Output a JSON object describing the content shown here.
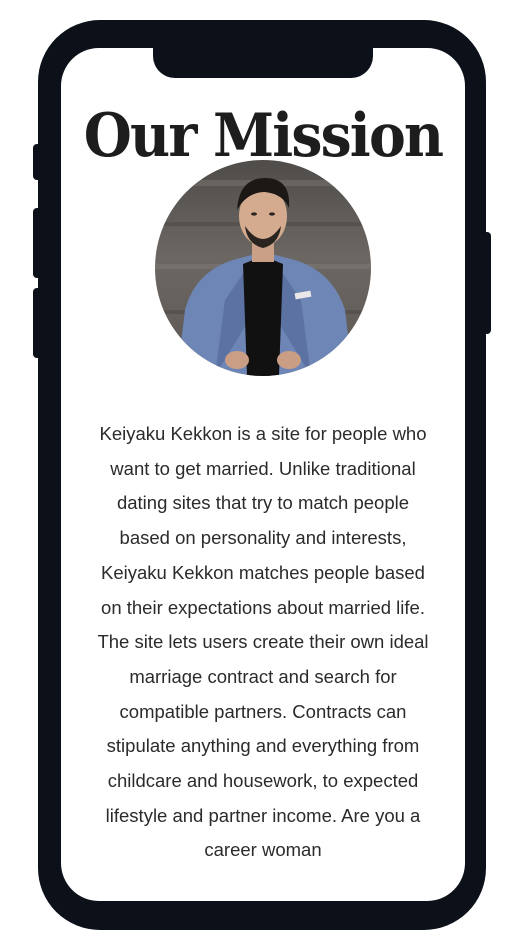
{
  "mission": {
    "title": "Our Mission",
    "photo_alt": "Keiyaku Kekkon founder portrait",
    "body": "Keiyaku Kekkon is a site for people who want to get married. Unlike traditional dating sites that try to match people based on personality and interests, Keiyaku Kekkon matches people based on their expectations about married life. The site lets users create their own ideal marriage contract and search for compatible partners. Contracts can stipulate anything and everything from childcare and housework, to expected lifestyle and partner income. Are you a career woman"
  },
  "colors": {
    "phone_frame": "#0b1019",
    "screen": "#ffffff",
    "title_text": "#1d1d1d",
    "body_text": "#2b2b2b"
  }
}
